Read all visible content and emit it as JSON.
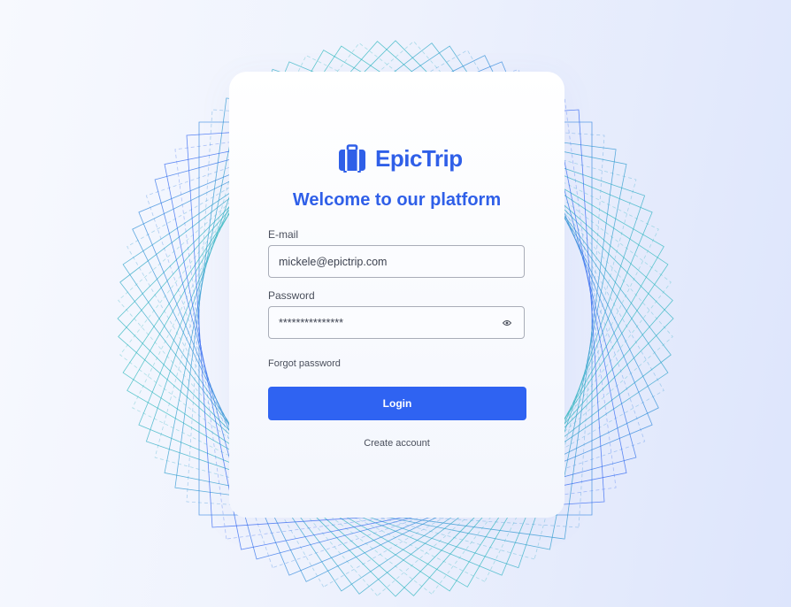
{
  "brand": {
    "name": "EpicTrip",
    "color": "#2f5fe8",
    "icon": "suitcase-icon"
  },
  "title": "Welcome to our platform",
  "email": {
    "label": "E-mail",
    "value": "mickele@epictrip.com"
  },
  "password": {
    "label": "Password",
    "value": "***************",
    "toggle_icon": "eye-icon"
  },
  "forgot_label": "Forgot password",
  "login_label": "Login",
  "create_label": "Create account",
  "colors": {
    "primary": "#2f63f2",
    "accent_teal": "#2cc2b6"
  }
}
